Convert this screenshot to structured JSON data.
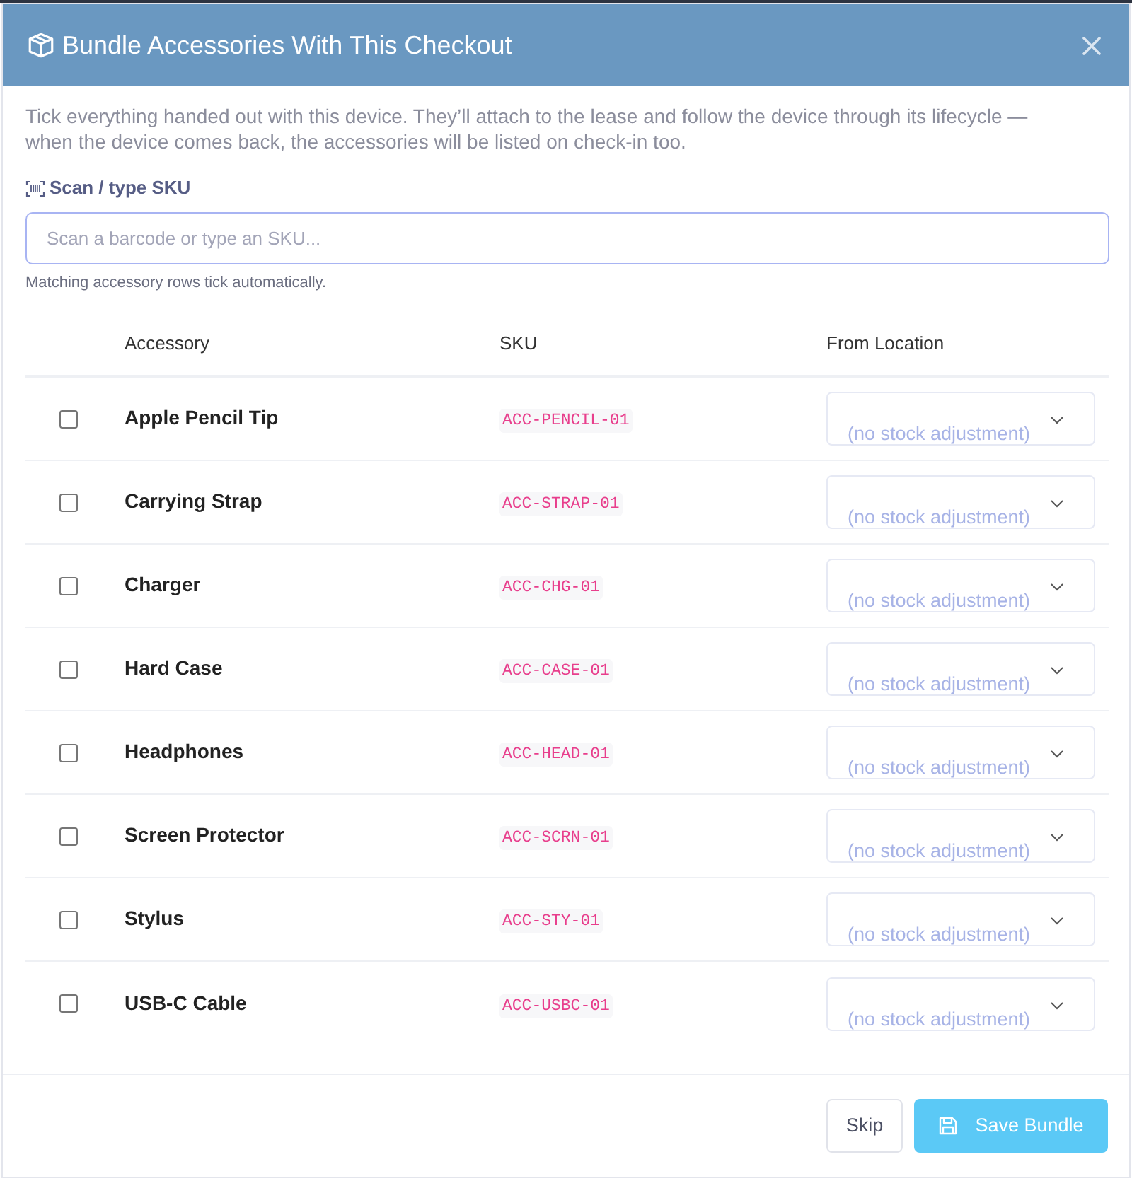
{
  "dialog": {
    "title": "Bundle Accessories With This Checkout"
  },
  "description": "Tick everything handed out with this device. They’ll attach to the lease and follow the device through its lifecycle — when the device comes back, the accessories will be listed on check-in too.",
  "scan": {
    "label": "Scan / type SKU",
    "placeholder": "Scan a barcode or type an SKU...",
    "hint": "Matching accessory rows tick automatically."
  },
  "table": {
    "columns": [
      "Accessory",
      "SKU",
      "From Location"
    ],
    "rows": [
      {
        "checked": false,
        "name": "Apple Pencil Tip",
        "sku": "ACC-PENCIL-01",
        "location": "(no stock adjustment)"
      },
      {
        "checked": false,
        "name": "Carrying Strap",
        "sku": "ACC-STRAP-01",
        "location": "(no stock adjustment)"
      },
      {
        "checked": false,
        "name": "Charger",
        "sku": "ACC-CHG-01",
        "location": "(no stock adjustment)"
      },
      {
        "checked": false,
        "name": "Hard Case",
        "sku": "ACC-CASE-01",
        "location": "(no stock adjustment)"
      },
      {
        "checked": false,
        "name": "Headphones",
        "sku": "ACC-HEAD-01",
        "location": "(no stock adjustment)"
      },
      {
        "checked": false,
        "name": "Screen Protector",
        "sku": "ACC-SCRN-01",
        "location": "(no stock adjustment)"
      },
      {
        "checked": false,
        "name": "Stylus",
        "sku": "ACC-STY-01",
        "location": "(no stock adjustment)"
      },
      {
        "checked": false,
        "name": "USB-C Cable",
        "sku": "ACC-USBC-01",
        "location": "(no stock adjustment)"
      }
    ]
  },
  "footer": {
    "buttons": [
      {
        "kind": "secondary",
        "label": "Skip"
      },
      {
        "kind": "primary",
        "label": "Save Bundle"
      }
    ]
  }
}
